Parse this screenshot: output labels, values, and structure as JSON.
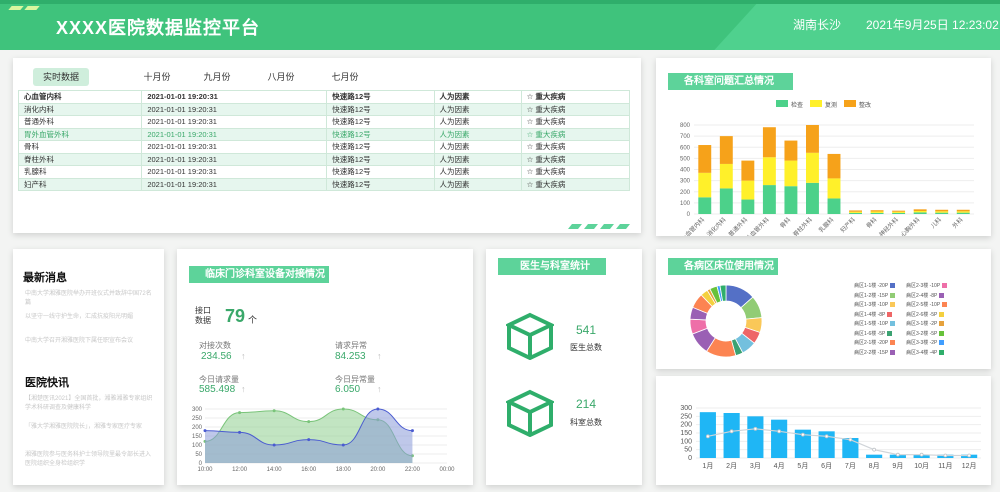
{
  "header": {
    "title": "XXXX医院数据监控平台",
    "location": "湖南长沙",
    "datetime": "2021年9月25日 12:23:02"
  },
  "table_panel": {
    "tabs": [
      "实时数据",
      "十月份",
      "九月份",
      "八月份",
      "七月份"
    ],
    "columns": [
      "心血管内科",
      "2021-01-01 19:20:31",
      "快速路12号",
      "人为因素",
      "☆ 重大疾病"
    ],
    "rows": [
      [
        "消化内科",
        "2021-01-01 19:20:31",
        "快速路12号",
        "人为因素",
        "☆ 重大疾病"
      ],
      [
        "普通外科",
        "2021-01-01 19:20:31",
        "快速路12号",
        "人为因素",
        "☆ 重大疾病"
      ],
      [
        "胃外血管外科",
        "2021-01-01 19:20:31",
        "快速路12号",
        "人为因素",
        "☆ 重大疾病"
      ],
      [
        "骨科",
        "2021-01-01 19:20:31",
        "快速路12号",
        "人为因素",
        "☆ 重大疾病"
      ],
      [
        "脊柱外科",
        "2021-01-01 19:20:31",
        "快速路12号",
        "人为因素",
        "☆ 重大疾病"
      ],
      [
        "乳腺科",
        "2021-01-01 19:20:31",
        "快速路12号",
        "人为因素",
        "☆ 重大疾病"
      ],
      [
        "妇产科",
        "2021-01-01 19:20:31",
        "快速路12号",
        "人为因素",
        "☆ 重大疾病"
      ]
    ]
  },
  "news": {
    "latest_title": "最新消息",
    "latest_items": [
      "中南大学湘雅医院举办开班仪式并致辞中国72名篇",
      "以坚守一线守护生命，汇成抗疫阳光明媚",
      "中南大学召开湘雅医院下属任职宣布会议"
    ],
    "express_title": "医院快讯",
    "express_items": [
      "【湘楚医讯2021】全国首批，湘雅湘雅专家组织学术科研调查及健康科学",
      "「雅大学湘雅医院院长」，湘雅专家医疗专家",
      "湘雅医院参与医务科护士领导院里最令部长进入医院组织全身检组织学"
    ]
  },
  "clinic": {
    "title": "临床门诊科室设备对接情况",
    "interface_label": "接口数据",
    "interface_value": "79",
    "interface_unit": "个",
    "stats": [
      {
        "label": "对接次数",
        "value": "234.56"
      },
      {
        "label": "请求异常",
        "value": "84.253"
      },
      {
        "label": "今日请求量",
        "value": "585.498"
      },
      {
        "label": "今日异常量",
        "value": "6.050"
      }
    ],
    "arrow": "↑"
  },
  "doctors": {
    "title": "医生与科室统计",
    "doctor_count": "541",
    "doctor_label": "医生总数",
    "room_count": "214",
    "room_label": "科室总数"
  },
  "beds": {
    "title": "各病区床位使用情况",
    "legend": [
      {
        "label": "病区1-1楼 -20P",
        "color": "#5470c6"
      },
      {
        "label": "病区2-3楼 -10P",
        "color": "#ee6fa8"
      },
      {
        "label": "病区1-2楼 -15P",
        "color": "#91cc75"
      },
      {
        "label": "病区2-4楼 -8P",
        "color": "#9a60b4"
      },
      {
        "label": "病区1-3楼 -10P",
        "color": "#fac858"
      },
      {
        "label": "病区2-5楼 -10P",
        "color": "#fc8452"
      },
      {
        "label": "病区1-4楼 -8P",
        "color": "#ee6666"
      },
      {
        "label": "病区2-6楼 -5P",
        "color": "#f4d03f"
      },
      {
        "label": "病区1-5楼 -10P",
        "color": "#73c0de"
      },
      {
        "label": "病区3-1楼 -2P",
        "color": "#e6a23c"
      },
      {
        "label": "病区1-6楼 -5P",
        "color": "#3ba272"
      },
      {
        "label": "病区3-2楼 -5P",
        "color": "#67c23a"
      },
      {
        "label": "病区2-1楼 -20P",
        "color": "#fc8452"
      },
      {
        "label": "病区3-3楼 -2P",
        "color": "#409eff"
      },
      {
        "label": "病区2-2楼 -15P",
        "color": "#9a60b4"
      },
      {
        "label": "病区3-4楼 -4P",
        "color": "#2fae6b"
      }
    ]
  },
  "summary": {
    "title": "各科室问题汇总情况"
  },
  "colors": {
    "header": "#4fd18e",
    "accent": "#5dd39a",
    "text_green": "#3aa86a"
  },
  "chart_data": [
    {
      "type": "bar",
      "stacked": true,
      "categories": [
        "心血管内科",
        "消化内科",
        "普通外科",
        "胃外血管外科",
        "骨科",
        "脊柱外科",
        "乳腺科",
        "妇产科",
        "骨科",
        "神经外科",
        "心胸外科",
        "儿科",
        "外科"
      ],
      "series": [
        {
          "name": "检查",
          "color": "#4cd18a",
          "values": [
            150,
            230,
            130,
            260,
            250,
            280,
            140,
            10,
            10,
            10,
            15,
            12,
            12
          ]
        },
        {
          "name": "复测",
          "color": "#fff02a",
          "values": [
            220,
            220,
            170,
            250,
            230,
            270,
            180,
            10,
            12,
            10,
            12,
            12,
            12
          ]
        },
        {
          "name": "整改",
          "color": "#f6a21a",
          "values": [
            250,
            250,
            180,
            270,
            180,
            250,
            220,
            12,
            12,
            10,
            15,
            14,
            14
          ]
        }
      ],
      "ylim": [
        0,
        800
      ],
      "yticks": [
        0,
        100,
        200,
        300,
        400,
        500,
        600,
        700,
        800
      ],
      "legend": "top"
    },
    {
      "type": "area",
      "x": [
        "10:00",
        "12:00",
        "14:00",
        "16:00",
        "18:00",
        "20:00",
        "22:00",
        "00:00"
      ],
      "series": [
        {
          "color": "#8fd08f",
          "values": [
            120,
            280,
            290,
            230,
            300,
            240,
            40
          ]
        },
        {
          "color": "#8a9bd8",
          "values": [
            180,
            170,
            100,
            130,
            100,
            300,
            180
          ]
        }
      ],
      "ylim": [
        0,
        300
      ],
      "yticks": [
        0,
        50,
        100,
        150,
        200,
        250,
        300
      ]
    },
    {
      "type": "pie",
      "donut": true,
      "values": [
        20,
        15,
        10,
        8,
        10,
        5,
        20,
        15,
        10,
        8,
        10,
        5,
        2,
        5,
        2,
        4
      ],
      "colors": [
        "#5470c6",
        "#91cc75",
        "#fac858",
        "#ee6666",
        "#73c0de",
        "#3ba272",
        "#fc8452",
        "#9a60b4",
        "#ee6fa8",
        "#9a60b4",
        "#fc8452",
        "#f4d03f",
        "#e6a23c",
        "#67c23a",
        "#409eff",
        "#2fae6b"
      ]
    },
    {
      "type": "bar",
      "categories": [
        "1月",
        "2月",
        "3月",
        "4月",
        "5月",
        "6月",
        "7月",
        "8月",
        "9月",
        "10月",
        "11月",
        "12月"
      ],
      "values": [
        275,
        270,
        250,
        230,
        170,
        160,
        120,
        20,
        20,
        20,
        20,
        20
      ],
      "line_values": [
        130,
        160,
        175,
        160,
        140,
        130,
        110,
        50,
        20,
        20,
        15,
        15
      ],
      "bar_color": "#1fb6f5",
      "ylim": [
        0,
        300
      ],
      "yticks": [
        0,
        50,
        100,
        150,
        200,
        250,
        300
      ]
    }
  ]
}
